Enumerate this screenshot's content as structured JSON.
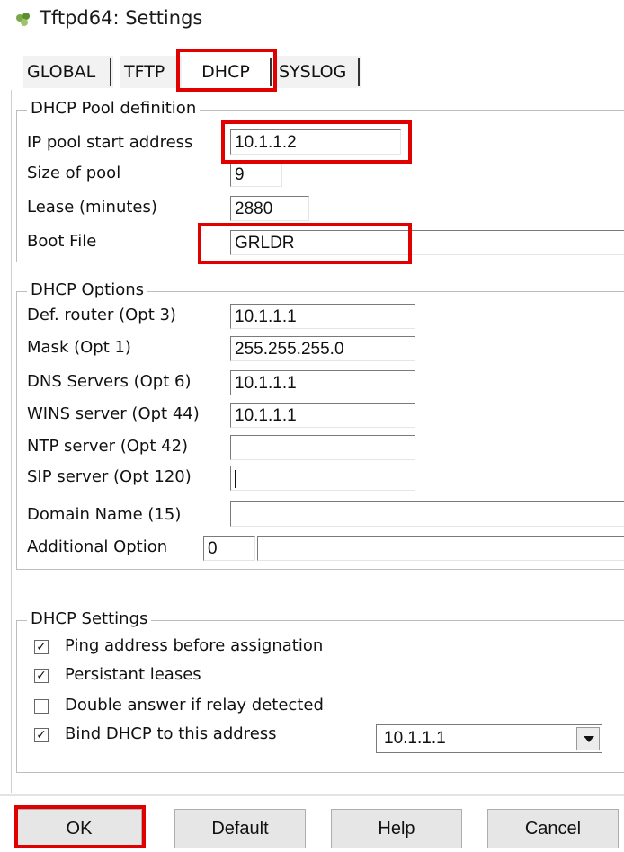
{
  "window": {
    "title": "Tftpd64: Settings",
    "icon": "tftpd-app-icon"
  },
  "tabs": [
    {
      "label": "GLOBAL",
      "active": false
    },
    {
      "label": "TFTP",
      "active": false
    },
    {
      "label": "DHCP",
      "active": true
    },
    {
      "label": "SYSLOG",
      "active": false
    }
  ],
  "pool": {
    "legend": "DHCP Pool definition",
    "start_label": "IP pool start address",
    "start_value": "10.1.1.2",
    "size_label": "Size of pool",
    "size_value": "9",
    "lease_label": "Lease (minutes)",
    "lease_value": "2880",
    "boot_label": "Boot File",
    "boot_value": "GRLDR"
  },
  "options": {
    "legend": "DHCP Options",
    "router_label": "Def. router (Opt 3)",
    "router_value": "10.1.1.1",
    "mask_label": "Mask (Opt 1)",
    "mask_value": "255.255.255.0",
    "dns_label": "DNS Servers (Opt 6)",
    "dns_value": "10.1.1.1",
    "wins_label": "WINS server (Opt 44)",
    "wins_value": "10.1.1.1",
    "ntp_label": "NTP server (Opt 42)",
    "ntp_value": "",
    "sip_label": "SIP server (Opt 120)",
    "sip_value": "",
    "domain_label": "Domain Name (15)",
    "domain_value": "",
    "additional_label": "Additional Option",
    "additional_num": "0",
    "additional_value": ""
  },
  "settings": {
    "legend": "DHCP Settings",
    "ping": {
      "label": "Ping address before assignation",
      "checked": true,
      "mark": "✓"
    },
    "persist": {
      "label": "Persistant leases",
      "checked": true,
      "mark": "✓"
    },
    "double": {
      "label": "Double answer if relay detected",
      "checked": false,
      "mark": ""
    },
    "bind": {
      "label": "Bind DHCP to this address",
      "checked": true,
      "mark": "✓"
    },
    "bind_address": "10.1.1.1"
  },
  "buttons": {
    "ok": "OK",
    "default": "Default",
    "help": "Help",
    "cancel": "Cancel"
  },
  "highlight_color": "#e00000"
}
